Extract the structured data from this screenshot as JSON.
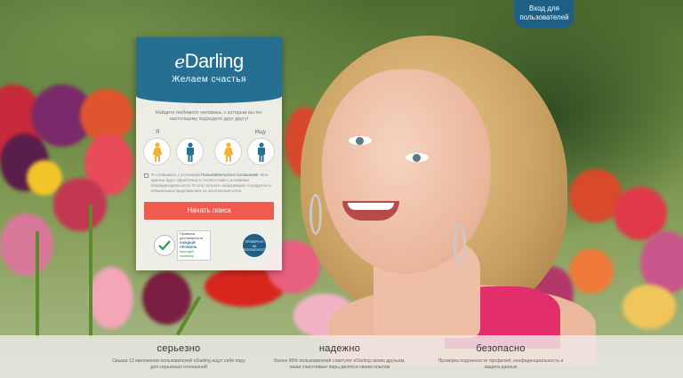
{
  "header": {
    "login_label_line1": "Вход для",
    "login_label_line2": "пользователей"
  },
  "signup": {
    "logo_e": "e",
    "logo_rest": "Darling",
    "tagline": "Желаем счастья",
    "subtitle": "Найдите любимого человека, с которым вы по-настоящему подходите друг другу!",
    "i_am_label": "Я",
    "seeking_label": "Ищу",
    "terms_prefix": "Я соглашаюсь с условиями",
    "terms_link": "Пользовательского Соглашения",
    "terms_rest": "Мои данные будут обработаны в соответствии с условиями Конфиденциальности. Я хочу получать информацию о продуктах и специальных предложениях по электронной почте.",
    "start_button": "Начать поиск",
    "badge_text_line1": "Проверка достоверности",
    "badge_text_line2": "КАЖДЫЙ ПРОФИЛЬ",
    "badge_text_line3": "проходит проверку",
    "seal_text": "ПРОВЕРЕНО НА БЕЗОПАСНОСТЬ"
  },
  "features": [
    {
      "title": "серьезно",
      "desc": "Свыше 13 миллионов пользователей eDarling ищут себе пару для серьезных отношений"
    },
    {
      "title": "надежно",
      "desc": "Более 80% пользователей советуют eDarling своим друзьям, наши счастливые пары делятся своим опытом"
    },
    {
      "title": "безопасно",
      "desc": "Проверка подлинности профилей, конфиденциальность и защита данных"
    }
  ],
  "colors": {
    "brand": "#256f93",
    "cta": "#ef5b4f",
    "female_icon": "#f2b531",
    "male_icon": "#256f93"
  },
  "icons": {
    "female": "female-person-icon",
    "male": "male-person-icon",
    "check": "checkmark-icon",
    "seal": "security-seal-icon"
  }
}
